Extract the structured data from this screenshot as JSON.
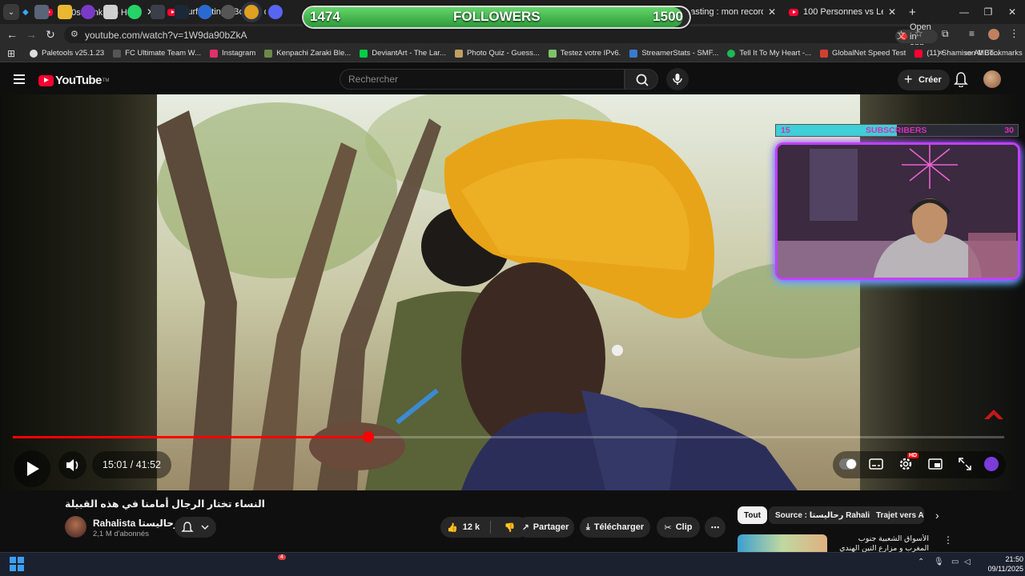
{
  "browser": {
    "tabs": [
      {
        "title": "【70s Funk Hip Hop】#26 Classi",
        "active": false
      },
      {
        "title": "Surfcasting : Bougre de congre",
        "active": false
      },
      {
        "title": "rfcasting : mon record bar",
        "active": false
      },
      {
        "title": "100 Personnes vs Les Plus Gr",
        "active": false
      }
    ],
    "url": "youtube.com/watch?v=1W9da90bZkA",
    "open_in_app": "Open in app",
    "bookmarks": [
      {
        "label": "Paletools v25.1.23",
        "color": "#dddddd"
      },
      {
        "label": "FC Ultimate Team W...",
        "color": "#555555"
      },
      {
        "label": "Instagram",
        "color": "#e1306c"
      },
      {
        "label": "Kenpachi Zaraki Ble...",
        "color": "#6a8a4a"
      },
      {
        "label": "DeviantArt - The Lar...",
        "color": "#05cc47"
      },
      {
        "label": "Photo Quiz - Guess...",
        "color": "#c0a060"
      },
      {
        "label": "Testez votre IPv6.",
        "color": "#7cc36a"
      },
      {
        "label": "StreamerStats - SMF...",
        "color": "#3a7acc"
      },
      {
        "label": "Tell It To My Heart -...",
        "color": "#1db954"
      },
      {
        "label": "GlobalNet Speed Test",
        "color": "#d04030"
      },
      {
        "label": "(11) Shamisen MET...",
        "color": "#ff0033"
      }
    ],
    "all_bookmarks": "All Bookmarks"
  },
  "overlay": {
    "followers_current": "1474",
    "followers_label": "FOLLOWERS",
    "followers_goal": "1500",
    "followers_progress": 0.983,
    "subs_current": "15",
    "subs_label": "SUBSCRIBERS",
    "subs_goal": "30",
    "subs_progress": 0.5
  },
  "youtube": {
    "logo": "YouTube",
    "logo_tm": "TM",
    "search_placeholder": "Rechercher",
    "create_label": "Créer"
  },
  "player": {
    "time": "15:01 / 41:52",
    "progress": 0.3586,
    "hd_badge": "HD"
  },
  "video": {
    "title": "النساء تختار الرجال أمامنا في هذه القبيلة",
    "channel": "Rahalista رحاليستا",
    "subscribers": "2,1 M d'abonnés",
    "likes": "12 k",
    "share": "Partager",
    "download": "Télécharger",
    "clip": "Clip"
  },
  "filters": [
    "Tout",
    "Source : رحاليستا Rahalista",
    "Trajet vers Afr"
  ],
  "recommendation": {
    "title": "الأسواق الشعبية جنوب المغرب و مزارع التين الهندي الأصيلة"
  },
  "taskbar": {
    "time": "21:50",
    "date": "09/11/2025",
    "discord_badge": "4"
  }
}
